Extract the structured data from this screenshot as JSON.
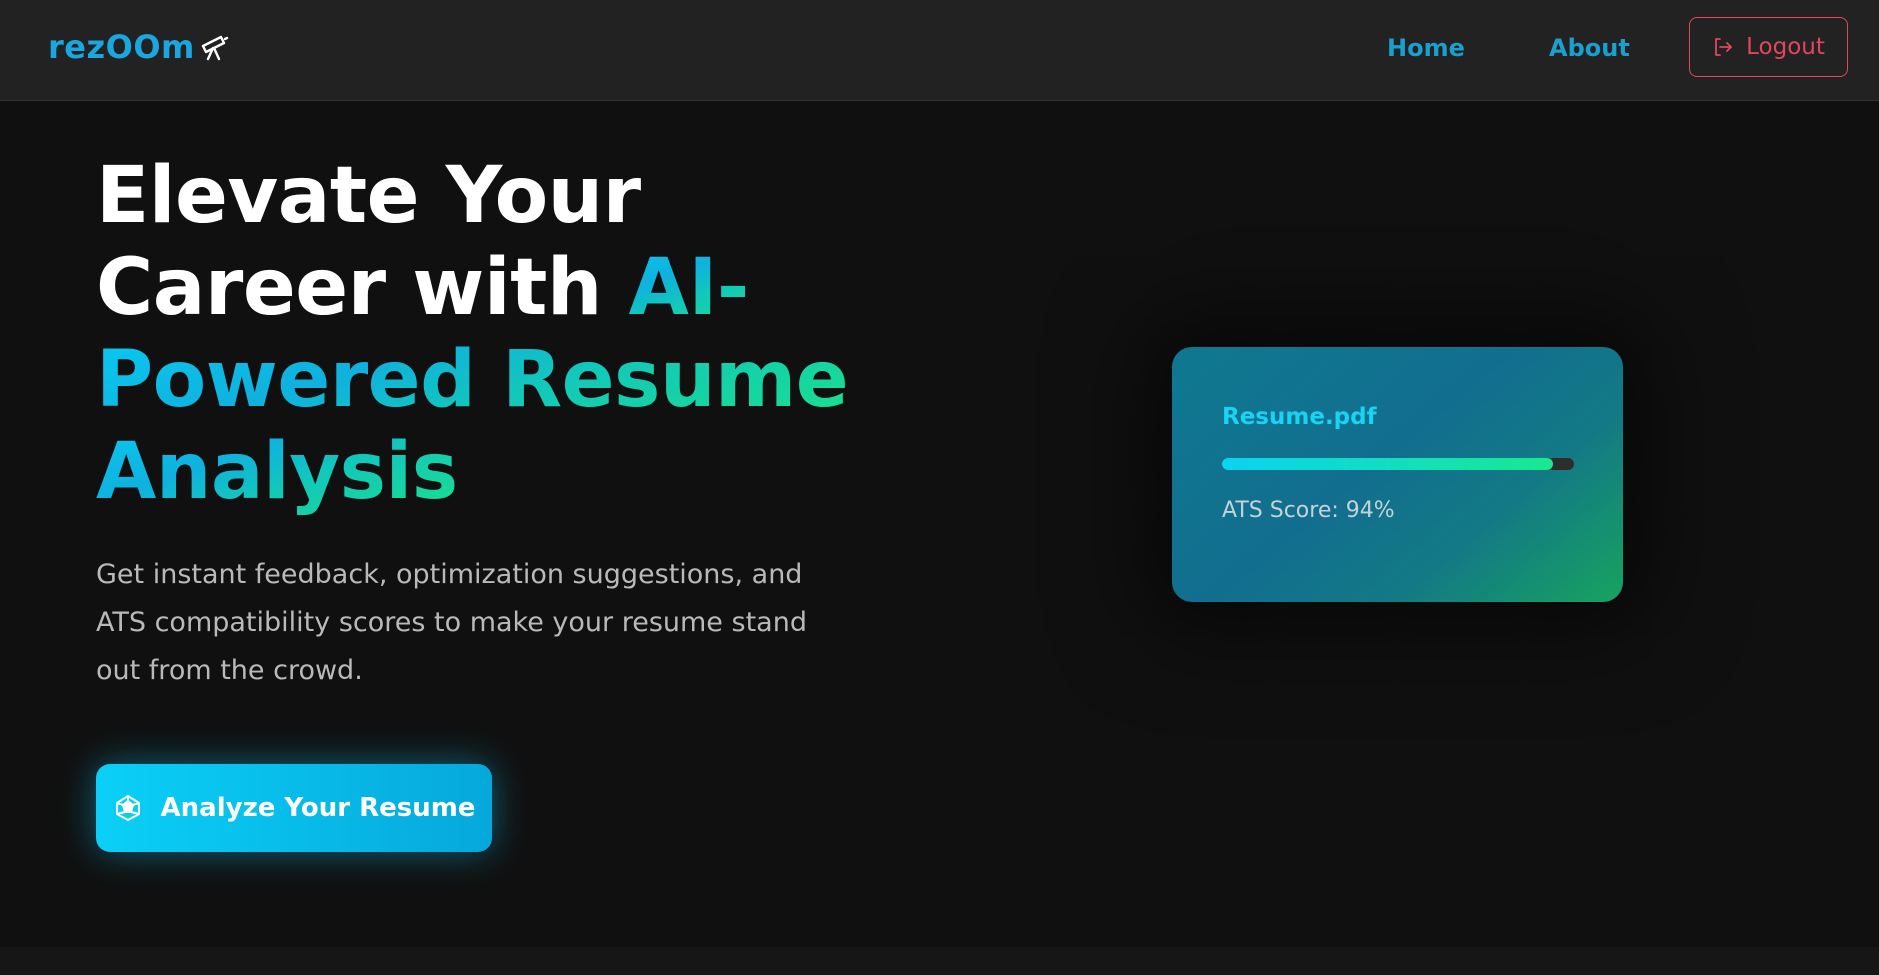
{
  "nav": {
    "brand": "rezOOm",
    "brand_icon": "telescope-icon",
    "home_label": "Home",
    "about_label": "About",
    "logout_label": "Logout",
    "logout_icon": "logout-icon"
  },
  "hero": {
    "headline_line1": "Elevate Your",
    "headline_line2_plain": "Career with ",
    "headline_line2_accent": "AI-",
    "headline_line3": "Powered Resume",
    "headline_line4": "Analysis",
    "subtext": "Get instant feedback, optimization suggestions, and ATS compatibility scores to make your resume stand out from the crowd.",
    "cta_label": "Analyze Your Resume",
    "cta_icon": "sparkle-icon"
  },
  "card": {
    "file_name": "Resume.pdf",
    "score_text": "ATS Score: 94%",
    "progress_fraction": 0.94
  },
  "colors": {
    "accent_cyan": "#0ac8f0",
    "accent_green": "#19e08d",
    "logout_red": "#e0475c",
    "background": "#101010"
  }
}
